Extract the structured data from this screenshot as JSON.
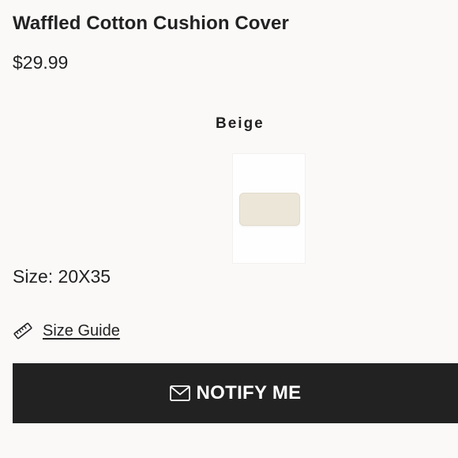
{
  "product": {
    "title": "Waffled Cotton Cushion Cover",
    "price": "$29.99"
  },
  "color": {
    "label": "Beige",
    "swatch_color": "#ece6d9"
  },
  "size": {
    "label": "Size: 20X35"
  },
  "size_guide": {
    "icon": "ruler-icon",
    "label": "Size Guide"
  },
  "notify": {
    "icon": "mail-icon",
    "label": "NOTIFY ME",
    "background": "#222222",
    "text_color": "#ffffff"
  }
}
